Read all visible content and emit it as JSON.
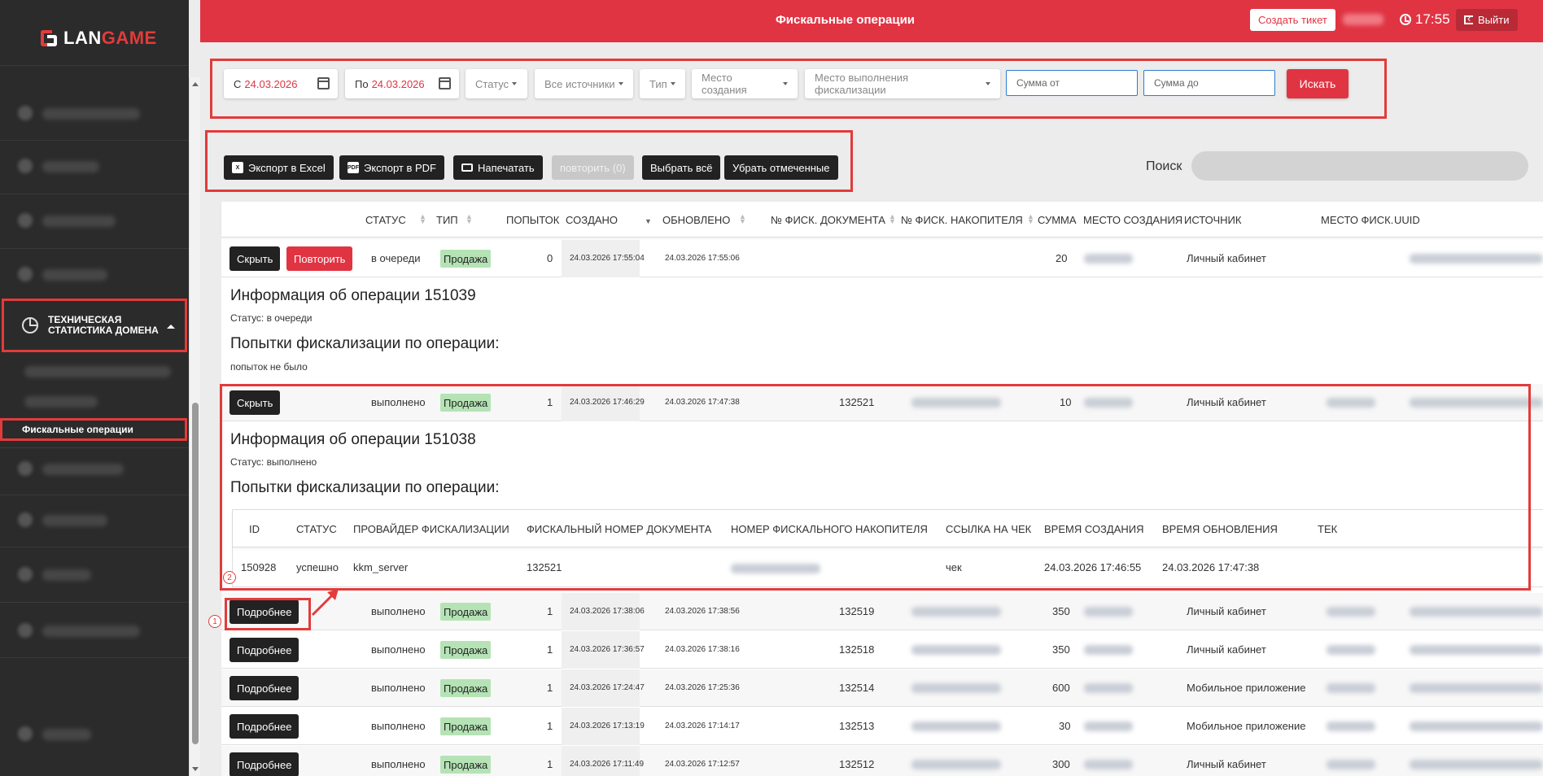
{
  "logo": {
    "prefix": "LAN",
    "suffix": "GAME"
  },
  "header": {
    "title": "Фискальные операции",
    "ticket_label": "Создать тикет",
    "time": "17:55",
    "logout_label": "Выйти"
  },
  "sidebar": {
    "active_section": "ТЕХНИЧЕСКАЯ СТАТИСТИКА ДОМЕНА",
    "active_item": "Фискальные операции"
  },
  "filters": {
    "from_label": "С",
    "from_date": "24.03.2026",
    "to_label": "По",
    "to_date": "24.03.2026",
    "status": "Статус",
    "sources": "Все источники",
    "type": "Тип",
    "creation_place": "Место создания",
    "fiscal_place": "Место выполнения фискализации",
    "sum_from_placeholder": "Сумма от",
    "sum_to_placeholder": "Сумма до",
    "search_button": "Искать"
  },
  "actions": {
    "export_excel": "Экспорт в Excel",
    "export_pdf": "Экспорт в PDF",
    "print": "Напечатать",
    "repeat": "повторить (0)",
    "select_all": "Выбрать всё",
    "unselect": "Убрать отмеченные"
  },
  "search": {
    "label": "Поиск"
  },
  "table": {
    "headers": {
      "status": "Статус",
      "type": "Тип",
      "attempts": "Попыток",
      "created": "Создано",
      "updated": "Обновлено",
      "fisc_doc": "№ фиск. документа",
      "fisc_storage": "№ фиск. накопителя",
      "sum": "Сумма",
      "creation_place": "Место создания",
      "source": "Источник",
      "fisc_place": "Место фиск.",
      "uuid": "UUID"
    },
    "rows": [
      {
        "btn": "Скрыть",
        "btn2": "Повторить",
        "status": "в очереди",
        "type": "Продажа",
        "attempts": "0",
        "created": "24.03.2026 17:55:04",
        "updated": "24.03.2026 17:55:06",
        "doc": "",
        "sum": "20",
        "source": "Личный кабинет"
      },
      {
        "btn": "Скрыть",
        "status": "выполнено",
        "type": "Продажа",
        "attempts": "1",
        "created": "24.03.2026 17:46:29",
        "updated": "24.03.2026 17:47:38",
        "doc": "132521",
        "sum": "10",
        "source": "Личный кабинет"
      },
      {
        "btn": "Подробнее",
        "status": "выполнено",
        "type": "Продажа",
        "attempts": "1",
        "created": "24.03.2026 17:38:06",
        "updated": "24.03.2026 17:38:56",
        "doc": "132519",
        "sum": "350",
        "source": "Личный кабинет"
      },
      {
        "btn": "Подробнее",
        "status": "выполнено",
        "type": "Продажа",
        "attempts": "1",
        "created": "24.03.2026 17:36:57",
        "updated": "24.03.2026 17:38:16",
        "doc": "132518",
        "sum": "350",
        "source": "Личный кабинет"
      },
      {
        "btn": "Подробнее",
        "status": "выполнено",
        "type": "Продажа",
        "attempts": "1",
        "created": "24.03.2026 17:24:47",
        "updated": "24.03.2026 17:25:36",
        "doc": "132514",
        "sum": "600",
        "source": "Мобильное приложение"
      },
      {
        "btn": "Подробнее",
        "status": "выполнено",
        "type": "Продажа",
        "attempts": "1",
        "created": "24.03.2026 17:13:19",
        "updated": "24.03.2026 17:14:17",
        "doc": "132513",
        "sum": "30",
        "source": "Мобильное приложение"
      },
      {
        "btn": "Подробнее",
        "status": "выполнено",
        "type": "Продажа",
        "attempts": "1",
        "created": "24.03.2026 17:11:49",
        "updated": "24.03.2026 17:12:57",
        "doc": "132512",
        "sum": "300",
        "source": "Личный кабинет"
      }
    ],
    "info1": {
      "title": "Информация об операции 151039",
      "status": "Статус: в очереди",
      "attempts_title": "Попытки фискализации по операции:",
      "no_attempts": "попыток не было"
    },
    "info2": {
      "title": "Информация об операции 151038",
      "status": "Статус: выполнено",
      "attempts_title": "Попытки фискализации по операции:"
    },
    "attempts_table": {
      "headers": {
        "id": "ID",
        "status": "Статус",
        "provider": "Провайдер фискализации",
        "doc": "Фискальный номер документа",
        "storage": "Номер фискального накопителя",
        "link": "Ссылка на чек",
        "created": "Время создания",
        "updated": "Время обновления",
        "more": "Тек"
      },
      "row": {
        "id": "150928",
        "status": "успешно",
        "provider": "kkm_server",
        "doc": "132521",
        "link": "чек",
        "created": "24.03.2026 17:46:55",
        "updated": "24.03.2026 17:47:38"
      }
    }
  },
  "annotations": {
    "marker1": "1",
    "marker2": "2"
  },
  "colors": {
    "brand": "#e03443",
    "sidebar": "#2b2b2b",
    "highlight": "#e23b3b",
    "badge": "#b5e3b5"
  }
}
